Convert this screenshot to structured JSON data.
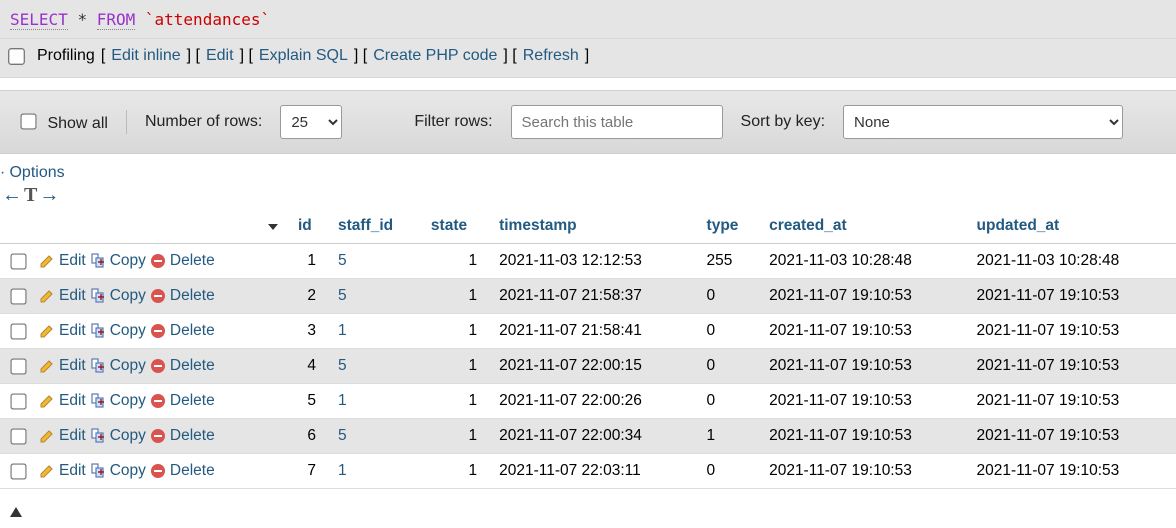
{
  "sql": {
    "kw_select": "SELECT",
    "star": "*",
    "kw_from": "FROM",
    "table_literal": "`attendances`"
  },
  "toolbar": {
    "profiling_label": "Profiling",
    "links": {
      "edit_inline": "Edit inline",
      "edit": "Edit",
      "explain_sql": "Explain SQL",
      "create_php": "Create PHP code",
      "refresh": "Refresh"
    }
  },
  "controls": {
    "show_all_label": "Show all",
    "rows_label": "Number of rows:",
    "rows_value": "25",
    "filter_label": "Filter rows:",
    "filter_placeholder": "Search this table",
    "sort_label": "Sort by key:",
    "sort_value": "None"
  },
  "options": {
    "options_label": "Options",
    "col_arrows": {
      "left": "←",
      "tbar": "T",
      "right": "→"
    }
  },
  "actions": {
    "edit": "Edit",
    "copy": "Copy",
    "delete": "Delete"
  },
  "columns": [
    {
      "key": "id",
      "label": "id",
      "sortable": true
    },
    {
      "key": "staff_id",
      "label": "staff_id",
      "sortable": true
    },
    {
      "key": "state",
      "label": "state",
      "sortable": true
    },
    {
      "key": "timestamp",
      "label": "timestamp",
      "sortable": true
    },
    {
      "key": "type",
      "label": "type",
      "sortable": true
    },
    {
      "key": "created_at",
      "label": "created_at",
      "sortable": true
    },
    {
      "key": "updated_at",
      "label": "updated_at",
      "sortable": true
    }
  ],
  "sorted_column": "id",
  "sort_dir": "desc",
  "rows": [
    {
      "id": 1,
      "staff_id": 5,
      "state": 1,
      "timestamp": "2021-11-03 12:12:53",
      "type": 255,
      "created_at": "2021-11-03 10:28:48",
      "updated_at": "2021-11-03 10:28:48"
    },
    {
      "id": 2,
      "staff_id": 5,
      "state": 1,
      "timestamp": "2021-11-07 21:58:37",
      "type": 0,
      "created_at": "2021-11-07 19:10:53",
      "updated_at": "2021-11-07 19:10:53"
    },
    {
      "id": 3,
      "staff_id": 1,
      "state": 1,
      "timestamp": "2021-11-07 21:58:41",
      "type": 0,
      "created_at": "2021-11-07 19:10:53",
      "updated_at": "2021-11-07 19:10:53"
    },
    {
      "id": 4,
      "staff_id": 5,
      "state": 1,
      "timestamp": "2021-11-07 22:00:15",
      "type": 0,
      "created_at": "2021-11-07 19:10:53",
      "updated_at": "2021-11-07 19:10:53"
    },
    {
      "id": 5,
      "staff_id": 1,
      "state": 1,
      "timestamp": "2021-11-07 22:00:26",
      "type": 0,
      "created_at": "2021-11-07 19:10:53",
      "updated_at": "2021-11-07 19:10:53"
    },
    {
      "id": 6,
      "staff_id": 5,
      "state": 1,
      "timestamp": "2021-11-07 22:00:34",
      "type": 1,
      "created_at": "2021-11-07 19:10:53",
      "updated_at": "2021-11-07 19:10:53"
    },
    {
      "id": 7,
      "staff_id": 1,
      "state": 1,
      "timestamp": "2021-11-07 22:03:11",
      "type": 0,
      "created_at": "2021-11-07 19:10:53",
      "updated_at": "2021-11-07 19:10:53"
    }
  ]
}
